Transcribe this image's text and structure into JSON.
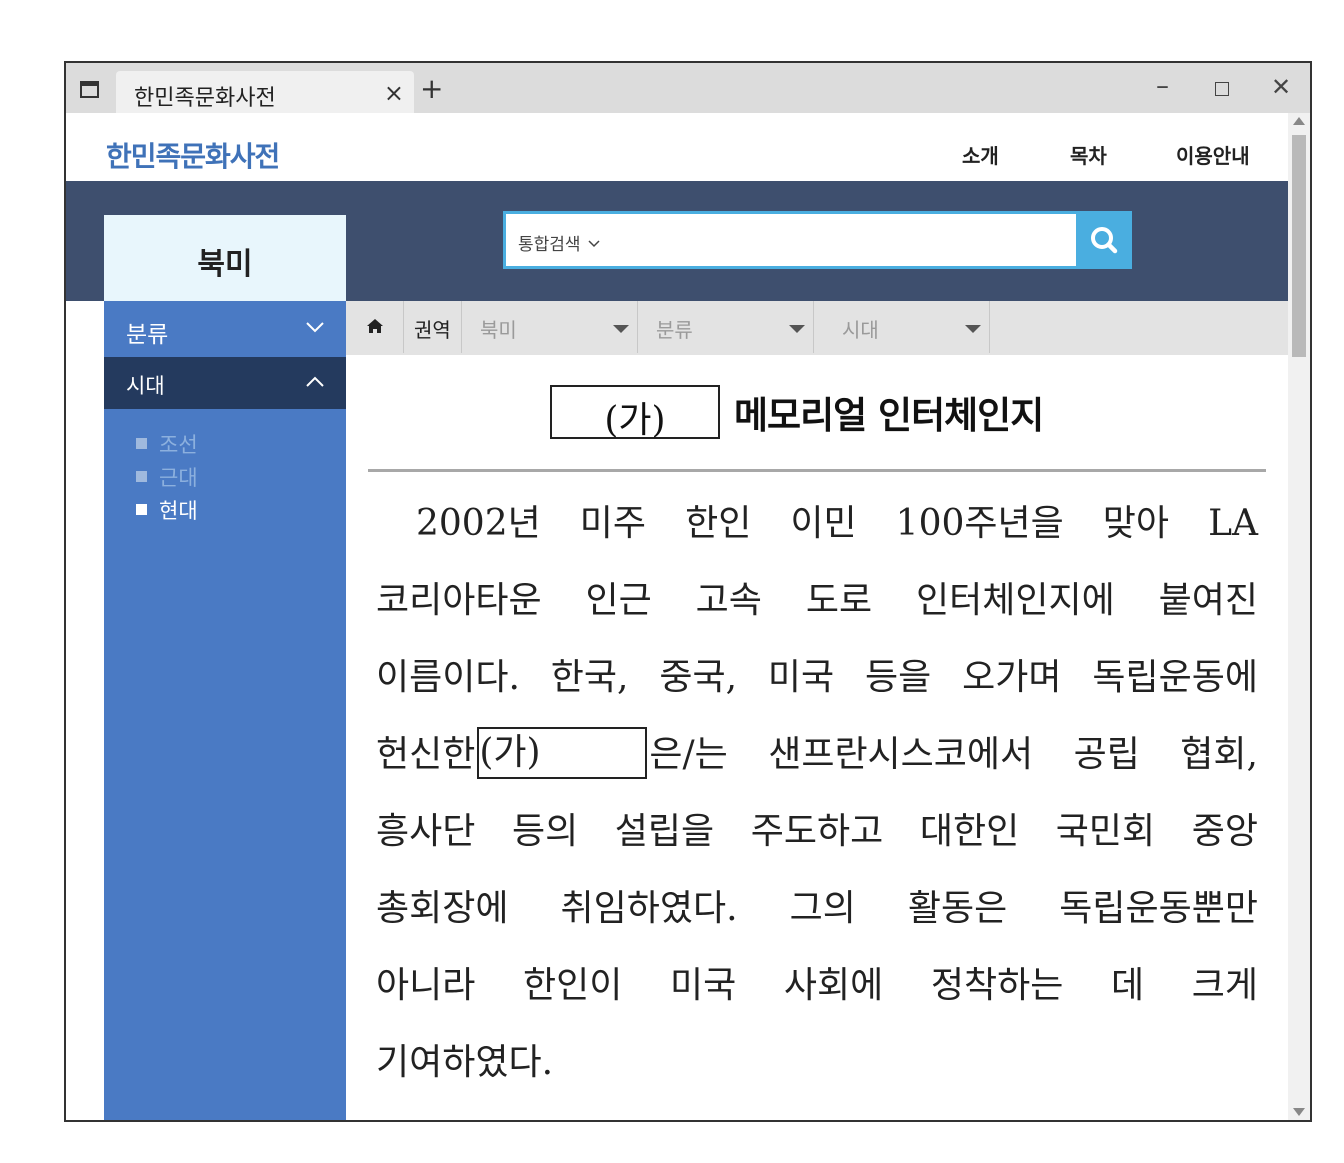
{
  "browser": {
    "tab_title": "한민족문화사전",
    "close_symbol": "×",
    "new_tab_symbol": "+",
    "minimize_symbol": "–",
    "close_window_symbol": "✕"
  },
  "header": {
    "logo": "한민족문화사전",
    "nav": {
      "intro": "소개",
      "toc": "목차",
      "guide": "이용안내"
    },
    "brand_color": "#3f72b8"
  },
  "hero": {
    "region": "북미",
    "search_type": "통합검색",
    "search_value": ""
  },
  "sidebar": {
    "category": "분류",
    "era": "시대",
    "items": [
      {
        "label": "조선",
        "state": "dim"
      },
      {
        "label": "근대",
        "state": "dim"
      },
      {
        "label": "현대",
        "state": "active"
      }
    ]
  },
  "breadcrumb": {
    "region_label": "권역",
    "region": "북미",
    "category": "분류",
    "era": "시대"
  },
  "article": {
    "title_blank": "(가)",
    "title": "메모리얼 인터체인지",
    "blank_label": "(가)",
    "lines": [
      "2002년 미주 한인 이민 100주년을 맞아 LA",
      "코리아타운 인근 고속 도로 인터체인지에 붙여진",
      "이름이다. 한국, 중국, 미국 등을 오가며 독립운동에",
      "헌신한",
      "은/는 샌프란시스코에서 공립 협회,",
      "흥사단 등의 설립을 주도하고 대한인 국민회 중앙",
      "총회장에 취임하였다. 그의 활동은 독립운동뿐만",
      "아니라 한인이 미국 사회에 정착하는 데 크게",
      "기여하였다."
    ]
  }
}
